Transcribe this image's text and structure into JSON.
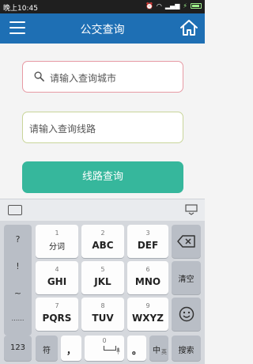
{
  "status_bar": {
    "time": "晚上10:45",
    "icons": [
      "alarm-icon",
      "wifi-icon",
      "signal-icon",
      "charging-icon",
      "battery-icon"
    ]
  },
  "app_bar": {
    "title": "公交查询",
    "menu_icon": "hamburger-menu-icon",
    "home_icon": "home-icon"
  },
  "form": {
    "city_placeholder": "请输入查询城市",
    "line_placeholder": "请输入查询线路",
    "submit_label": "线路查询",
    "accent_color": "#36b79c",
    "header_color": "#1e6fb4"
  },
  "keyboard": {
    "punctuation": [
      "?",
      "!",
      "~",
      "……"
    ],
    "keys": [
      {
        "num": "1",
        "label": "分词"
      },
      {
        "num": "2",
        "label": "ABC"
      },
      {
        "num": "3",
        "label": "DEF"
      },
      {
        "num": "4",
        "label": "GHI"
      },
      {
        "num": "5",
        "label": "JKL"
      },
      {
        "num": "6",
        "label": "MNO"
      },
      {
        "num": "7",
        "label": "PQRS"
      },
      {
        "num": "8",
        "label": "TUV"
      },
      {
        "num": "9",
        "label": "WXYZ"
      }
    ],
    "clear_label": "清空",
    "bottom": {
      "k123": "123",
      "symbol": "符",
      "comma": "，",
      "zero": "0",
      "period": "。",
      "lang": "中",
      "lang_sub": "英",
      "search": "搜索"
    }
  }
}
